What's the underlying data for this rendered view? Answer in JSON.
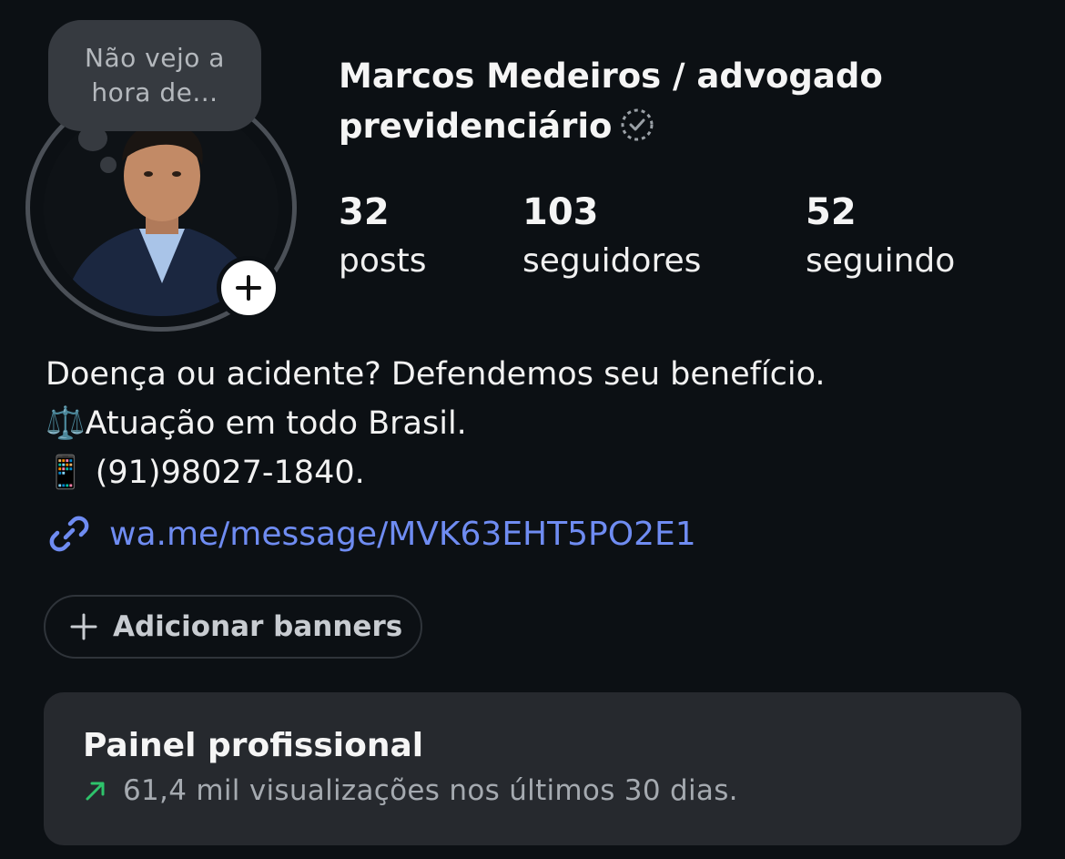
{
  "note": {
    "line1": "Não vejo a",
    "line2": "hora de..."
  },
  "profile": {
    "name_line1": "Marcos Medeiros / advogado",
    "name_line2": "previdenciário",
    "verified_icon": "verified-badge-icon"
  },
  "stats": [
    {
      "value": "32",
      "label": "posts"
    },
    {
      "value": "103",
      "label": "seguidores"
    },
    {
      "value": "52",
      "label": "seguindo"
    }
  ],
  "bio": {
    "line1": "Doença ou acidente? Defendemos seu benefício.",
    "line2_emoji": "⚖️",
    "line2_text": "Atuação em todo Brasil.",
    "line3_emoji": "📱",
    "line3_text": " (91)98027-1840."
  },
  "link": {
    "icon": "link-icon",
    "text": "wa.me/message/MVK63EHT5PO2E1",
    "color": "#6f8cf2"
  },
  "banner_button": {
    "label": "Adicionar banners"
  },
  "professional_panel": {
    "title": "Painel profissional",
    "subtitle": "61,4 mil visualizações nos últimos 30 dias.",
    "trend_color": "#2ec36b"
  }
}
